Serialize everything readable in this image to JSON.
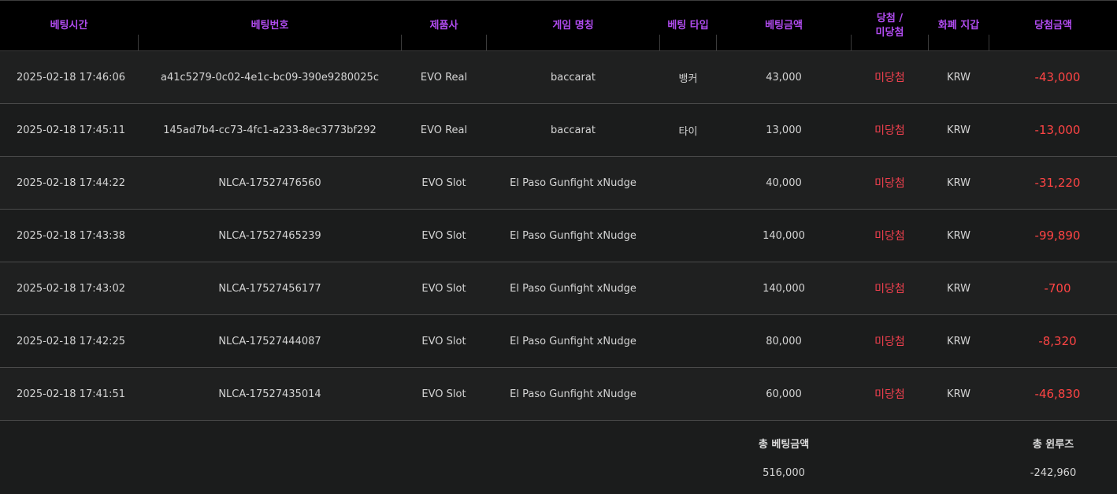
{
  "headers": {
    "bet_time": "베팅시간",
    "bet_id": "베팅번호",
    "provider": "제품사",
    "game_name": "게임 명칭",
    "bet_type": "베팅 타입",
    "bet_amount": "베팅금액",
    "result": "당첨 /\n미당첨",
    "currency": "화폐 지갑",
    "win_amount": "당첨금액"
  },
  "rows": [
    {
      "time": "2025-02-18 17:46:06",
      "id": "a41c5279-0c02-4e1c-bc09-390e9280025c",
      "provider": "EVO Real",
      "game": "baccarat",
      "type": "뱅커",
      "amount": "43,000",
      "result": "미당첨",
      "currency": "KRW",
      "win": "-43,000"
    },
    {
      "time": "2025-02-18 17:45:11",
      "id": "145ad7b4-cc73-4fc1-a233-8ec3773bf292",
      "provider": "EVO Real",
      "game": "baccarat",
      "type": "타이",
      "amount": "13,000",
      "result": "미당첨",
      "currency": "KRW",
      "win": "-13,000"
    },
    {
      "time": "2025-02-18 17:44:22",
      "id": "NLCA-17527476560",
      "provider": "EVO Slot",
      "game": "El Paso Gunfight xNudge",
      "type": "",
      "amount": "40,000",
      "result": "미당첨",
      "currency": "KRW",
      "win": "-31,220"
    },
    {
      "time": "2025-02-18 17:43:38",
      "id": "NLCA-17527465239",
      "provider": "EVO Slot",
      "game": "El Paso Gunfight xNudge",
      "type": "",
      "amount": "140,000",
      "result": "미당첨",
      "currency": "KRW",
      "win": "-99,890"
    },
    {
      "time": "2025-02-18 17:43:02",
      "id": "NLCA-17527456177",
      "provider": "EVO Slot",
      "game": "El Paso Gunfight xNudge",
      "type": "",
      "amount": "140,000",
      "result": "미당첨",
      "currency": "KRW",
      "win": "-700"
    },
    {
      "time": "2025-02-18 17:42:25",
      "id": "NLCA-17527444087",
      "provider": "EVO Slot",
      "game": "El Paso Gunfight xNudge",
      "type": "",
      "amount": "80,000",
      "result": "미당첨",
      "currency": "KRW",
      "win": "-8,320"
    },
    {
      "time": "2025-02-18 17:41:51",
      "id": "NLCA-17527435014",
      "provider": "EVO Slot",
      "game": "El Paso Gunfight xNudge",
      "type": "",
      "amount": "60,000",
      "result": "미당첨",
      "currency": "KRW",
      "win": "-46,830"
    }
  ],
  "summary": {
    "total_bet_label": "총 베팅금액",
    "total_bet_value": "516,000",
    "total_winloss_label": "총 윈루즈",
    "total_winloss_value": "-242,960"
  }
}
